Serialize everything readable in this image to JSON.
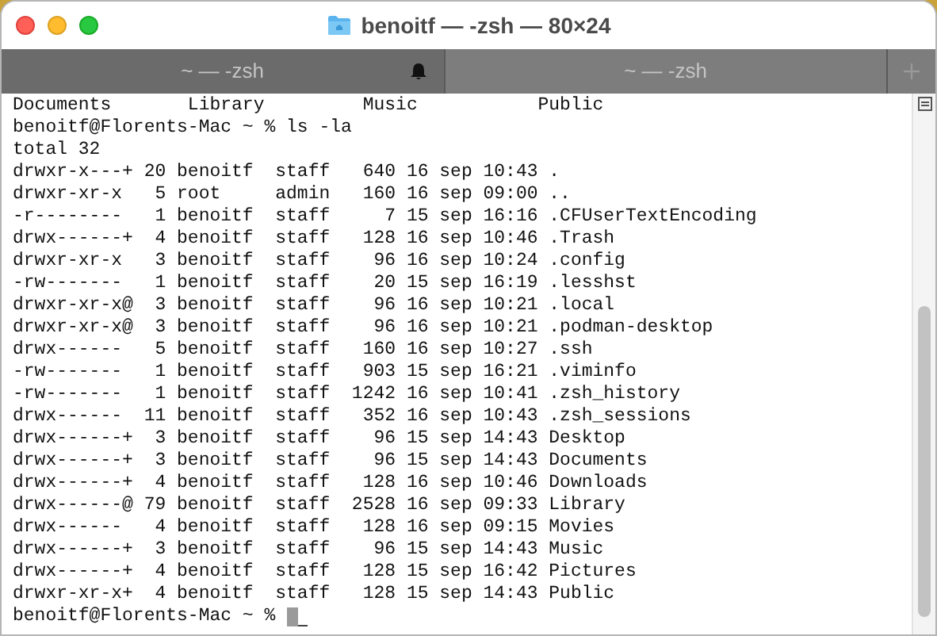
{
  "window": {
    "title": "benoitf — -zsh — 80×24"
  },
  "tabs": [
    {
      "label": "~ — -zsh",
      "selected": false,
      "bell": true
    },
    {
      "label": "~ — -zsh",
      "selected": true,
      "bell": false
    }
  ],
  "terminal": {
    "lines": [
      {
        "kind": "output",
        "text": "Documents       Library         Music           Public"
      },
      {
        "kind": "prompt",
        "text": "benoitf@Florents-Mac ~ % ls -la"
      },
      {
        "kind": "output",
        "text": "total 32"
      },
      {
        "kind": "output",
        "text": "drwxr-x---+ 20 benoitf  staff   640 16 sep 10:43 ."
      },
      {
        "kind": "output",
        "text": "drwxr-xr-x   5 root     admin   160 16 sep 09:00 .."
      },
      {
        "kind": "output",
        "text": "-r--------   1 benoitf  staff     7 15 sep 16:16 .CFUserTextEncoding"
      },
      {
        "kind": "output",
        "text": "drwx------+  4 benoitf  staff   128 16 sep 10:46 .Trash"
      },
      {
        "kind": "output",
        "text": "drwxr-xr-x   3 benoitf  staff    96 16 sep 10:24 .config"
      },
      {
        "kind": "output",
        "text": "-rw-------   1 benoitf  staff    20 15 sep 16:19 .lesshst"
      },
      {
        "kind": "output",
        "text": "drwxr-xr-x@  3 benoitf  staff    96 16 sep 10:21 .local"
      },
      {
        "kind": "output",
        "text": "drwxr-xr-x@  3 benoitf  staff    96 16 sep 10:21 .podman-desktop"
      },
      {
        "kind": "output",
        "text": "drwx------   5 benoitf  staff   160 16 sep 10:27 .ssh"
      },
      {
        "kind": "output",
        "text": "-rw-------   1 benoitf  staff   903 15 sep 16:21 .viminfo"
      },
      {
        "kind": "output",
        "text": "-rw-------   1 benoitf  staff  1242 16 sep 10:41 .zsh_history"
      },
      {
        "kind": "output",
        "text": "drwx------  11 benoitf  staff   352 16 sep 10:43 .zsh_sessions"
      },
      {
        "kind": "output",
        "text": "drwx------+  3 benoitf  staff    96 15 sep 14:43 Desktop"
      },
      {
        "kind": "output",
        "text": "drwx------+  3 benoitf  staff    96 15 sep 14:43 Documents"
      },
      {
        "kind": "output",
        "text": "drwx------+  4 benoitf  staff   128 16 sep 10:46 Downloads"
      },
      {
        "kind": "output",
        "text": "drwx------@ 79 benoitf  staff  2528 16 sep 09:33 Library"
      },
      {
        "kind": "output",
        "text": "drwx------   4 benoitf  staff   128 16 sep 09:15 Movies"
      },
      {
        "kind": "output",
        "text": "drwx------+  3 benoitf  staff    96 15 sep 14:43 Music"
      },
      {
        "kind": "output",
        "text": "drwx------+  4 benoitf  staff   128 15 sep 16:42 Pictures"
      },
      {
        "kind": "output",
        "text": "drwxr-xr-x+  4 benoitf  staff   128 15 sep 14:43 Public"
      },
      {
        "kind": "input",
        "text": "benoitf@Florents-Mac ~ % "
      }
    ]
  }
}
